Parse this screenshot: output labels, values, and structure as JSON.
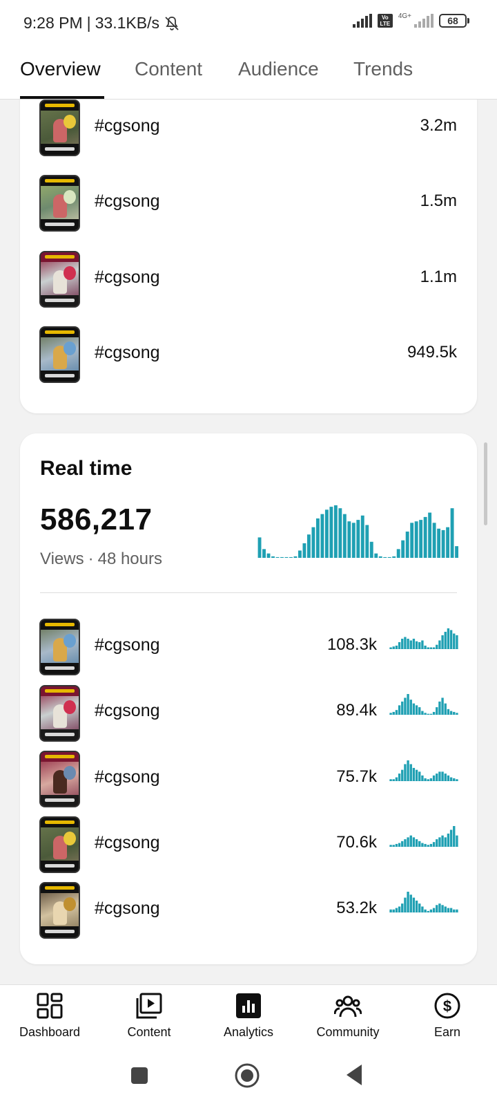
{
  "status_bar": {
    "time": "9:28 PM",
    "speed": "33.1KB/s",
    "network": "4G+",
    "volte": "Vo LTE",
    "battery": "68"
  },
  "tabs": [
    {
      "label": "Overview",
      "active": true
    },
    {
      "label": "Content",
      "active": false
    },
    {
      "label": "Audience",
      "active": false
    },
    {
      "label": "Trends",
      "active": false
    }
  ],
  "top_content": {
    "rows": [
      {
        "title": "#cgsong",
        "value": "3.2m"
      },
      {
        "title": "#cgsong",
        "value": "1.5m"
      },
      {
        "title": "#cgsong",
        "value": "1.1m"
      },
      {
        "title": "#cgsong",
        "value": "949.5k"
      }
    ]
  },
  "realtime": {
    "heading": "Real time",
    "total_views": "586,217",
    "views_label": "Views",
    "separator": "·",
    "period": "48 hours",
    "chart_data": {
      "type": "bar",
      "values": [
        28,
        12,
        6,
        2,
        1,
        1,
        1,
        1,
        2,
        10,
        20,
        32,
        42,
        54,
        60,
        66,
        70,
        72,
        68,
        60,
        50,
        48,
        52,
        58,
        45,
        22,
        6,
        2,
        1,
        1,
        2,
        12,
        24,
        36,
        48,
        50,
        52,
        56,
        62,
        48,
        40,
        38,
        42,
        68,
        16
      ],
      "color": "#1fa0b3"
    },
    "rows": [
      {
        "title": "#cgsong",
        "value": "108.3k",
        "spark": [
          2,
          3,
          4,
          8,
          12,
          14,
          12,
          10,
          12,
          9,
          8,
          10,
          4,
          2,
          2,
          2,
          5,
          10,
          16,
          20,
          24,
          22,
          18,
          16
        ]
      },
      {
        "title": "#cgsong",
        "value": "89.4k",
        "spark": [
          2,
          3,
          5,
          10,
          14,
          18,
          22,
          16,
          12,
          10,
          8,
          4,
          2,
          1,
          1,
          3,
          8,
          14,
          18,
          12,
          6,
          4,
          3,
          2
        ]
      },
      {
        "title": "#cgsong",
        "value": "75.7k",
        "spark": [
          2,
          2,
          4,
          8,
          12,
          18,
          22,
          18,
          14,
          12,
          10,
          6,
          3,
          2,
          3,
          6,
          8,
          10,
          10,
          8,
          6,
          4,
          3,
          2
        ]
      },
      {
        "title": "#cgsong",
        "value": "70.6k",
        "spark": [
          2,
          2,
          3,
          4,
          6,
          8,
          10,
          12,
          10,
          8,
          6,
          4,
          3,
          2,
          3,
          5,
          8,
          10,
          12,
          10,
          14,
          18,
          22,
          12
        ]
      },
      {
        "title": "#cgsong",
        "value": "53.2k",
        "spark": [
          2,
          2,
          3,
          4,
          6,
          10,
          14,
          12,
          10,
          8,
          6,
          4,
          2,
          1,
          2,
          3,
          5,
          6,
          5,
          4,
          3,
          3,
          2,
          2
        ]
      }
    ]
  },
  "bottom_nav": [
    {
      "label": "Dashboard",
      "icon": "dashboard-icon"
    },
    {
      "label": "Content",
      "icon": "content-icon"
    },
    {
      "label": "Analytics",
      "icon": "analytics-icon",
      "active": true
    },
    {
      "label": "Community",
      "icon": "community-icon"
    },
    {
      "label": "Earn",
      "icon": "earn-icon"
    }
  ],
  "colors": {
    "accent_chart": "#1fa0b3",
    "text_primary": "#0f0f0f",
    "text_secondary": "#606060",
    "background": "#f2f2f2"
  }
}
